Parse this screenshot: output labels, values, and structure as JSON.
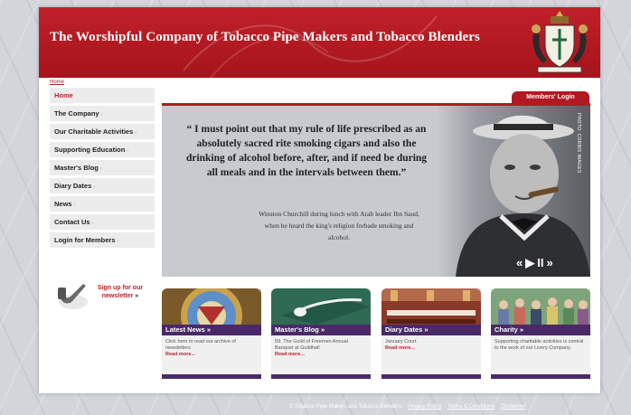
{
  "header": {
    "title": "The Worshipful Company of Tobacco Pipe Makers and Tobacco Blenders",
    "crest_icon": "coat-of-arms-icon"
  },
  "breadcrumb": "Home",
  "nav": {
    "items": [
      {
        "label": "Home",
        "active": true
      },
      {
        "label": "The Company",
        "active": false
      },
      {
        "label": "Our Charitable Activities",
        "active": false
      },
      {
        "label": "Supporting Education",
        "active": false
      },
      {
        "label": "Master's Blog",
        "active": false
      },
      {
        "label": "Diary Dates",
        "active": false
      },
      {
        "label": "News",
        "active": false
      },
      {
        "label": "Contact Us",
        "active": false
      },
      {
        "label": "Login for Members",
        "active": false
      }
    ]
  },
  "newsletter": {
    "line1": "Sign up for our",
    "line2": "newsletter",
    "arrow": "»"
  },
  "members_login": "Members' Login",
  "hero": {
    "quote_open": "“",
    "quote": "I must point out that my rule of life prescribed as an absolutely sacred rite smoking cigars and also the drinking of alcohol before, after, and if need be during all meals and in the intervals between them.",
    "quote_close": "”",
    "attribution": "Winston Churchill during lunch with Arab leader Ibn Saud, when he heard the king's religion forbade smoking and alcohol.",
    "photo_credit": "PHOTO: CORBIS IMAGES",
    "controls": {
      "prev": "«",
      "play": "▶",
      "pause": "II",
      "next": "»"
    }
  },
  "cards": [
    {
      "title": "Latest News »",
      "desc": "Click here to read our archive of newsletters",
      "more": "Read more..."
    },
    {
      "title": "Master's Blog »",
      "desc": "59. The Guild of Freemen Annual Banquet at Guildhall",
      "more": "Read more..."
    },
    {
      "title": "Diary Dates »",
      "desc": "January Court",
      "more": "Read more..."
    },
    {
      "title": "Charity »",
      "desc": "Supporting charitable activities is central to the work of our Livery Company.",
      "more": ""
    }
  ],
  "footer": {
    "copyright": "© Tobacco Pipe Makers and Tobacco Blenders",
    "links": [
      "Privacy Policy",
      "Terms & Conditions",
      "Disclaimer"
    ]
  },
  "colors": {
    "brand_red": "#b11a22",
    "card_purple": "#4a2a66",
    "background": "#d2d5da"
  }
}
